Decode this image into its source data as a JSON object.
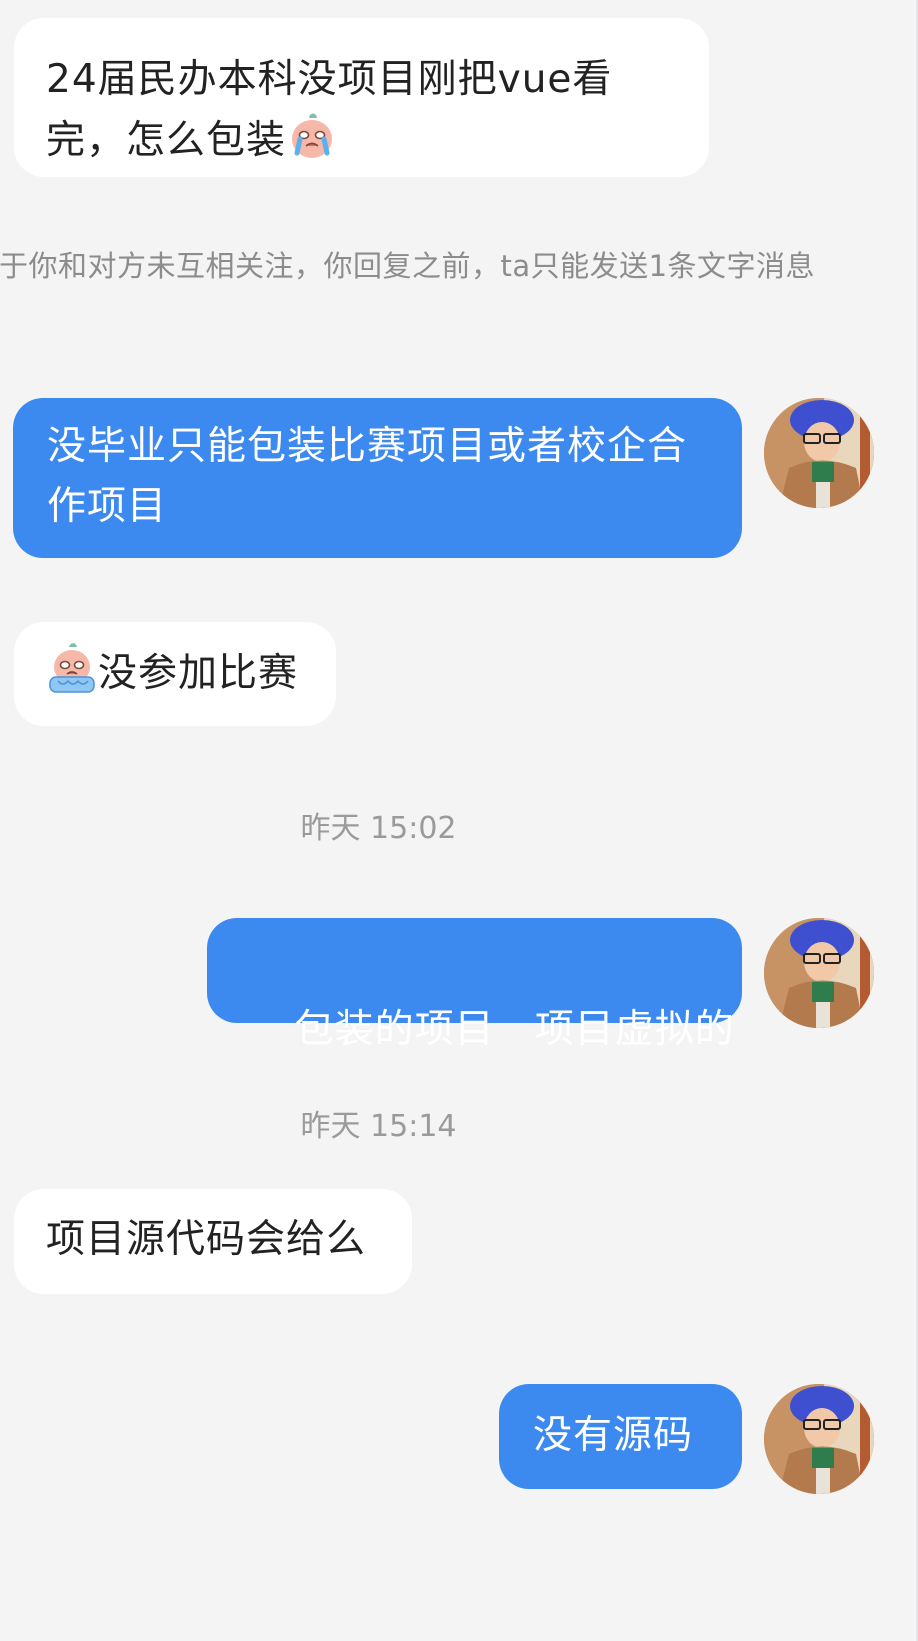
{
  "conversation": {
    "messages": [
      {
        "direction": "incoming",
        "text": "24届民办本科没项目刚把vue看完，怎么包装",
        "emoji": "crying-face-emoji"
      },
      {
        "direction": "incoming",
        "text": "没参加比赛",
        "emoji": "crying-face-emoji"
      },
      {
        "direction": "outgoing",
        "text": "没毕业只能包装比赛项目或者校企合作项目"
      },
      {
        "direction": "outgoing",
        "text": "包装的项目   项目虚拟的"
      },
      {
        "direction": "incoming",
        "text": "项目源代码会给么"
      },
      {
        "direction": "outgoing",
        "text": "没有源码"
      }
    ],
    "system_note": "于你和对方未互相关注，你回复之前，ta只能发送1条文字消息",
    "timestamps": [
      "昨天 15:02",
      "昨天 15:14"
    ]
  },
  "icons": {
    "avatar": "user-avatar-photo",
    "emoji": "crying-face-emoji"
  },
  "colors": {
    "background": "#f4f4f5",
    "incoming_bubble": "#ffffff",
    "outgoing_bubble": "#3c8af0",
    "incoming_text": "#222222",
    "outgoing_text": "#ffffff",
    "muted_text": "#8c8c8c"
  }
}
